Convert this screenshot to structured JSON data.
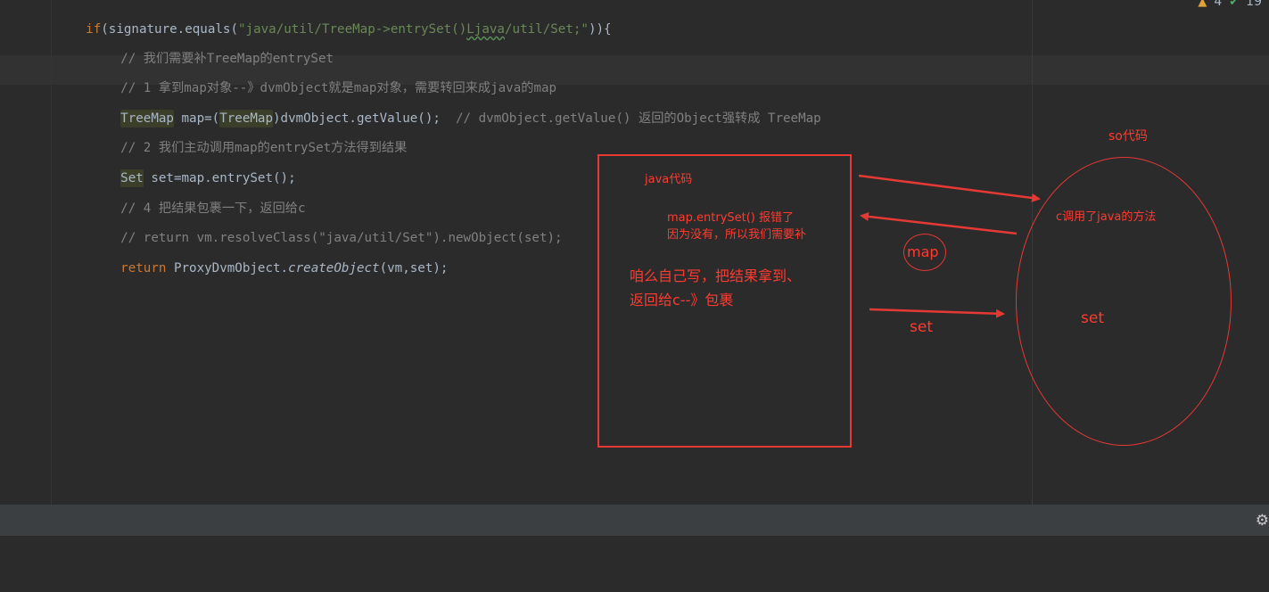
{
  "editor": {
    "lines": [
      {
        "if_kw": "if",
        "pre": "(signature.equals(",
        "str_a": "\"java/util/TreeMap->entrySet()",
        "str_b": "Ljava",
        "str_c": "/util/Set;\"",
        "post": ")){"
      },
      {
        "comment": "// 我们需要补TreeMap的entrySet"
      },
      {
        "comment": "// 1 拿到map对象--》dvmObject就是map对象，需要转回来成java的map"
      },
      {
        "type1": "TreeMap",
        "mid1": " map=(",
        "type2": "TreeMap",
        "mid2": ")dvmObject.getValue();",
        "semi": "",
        "comment": "  // dvmObject.getValue() 返回的Object强转成 TreeMap"
      },
      {
        "comment": "// 2 我们主动调用map的entrySet方法得到结果"
      },
      {
        "type1": "Set",
        "rest": " set=map.entrySet();"
      },
      {
        "comment": "// 4 把结果包裹一下，返回给c"
      },
      {
        "comment": "// return vm.resolveClass(\"java/util/Set\").newObject(set);"
      },
      {
        "ret_kw": "return",
        "pre": " ProxyDvmObject.",
        "method": "createObject",
        "post": "(vm,set);"
      }
    ],
    "inspection": {
      "warnings": "4",
      "ok": "19"
    }
  },
  "annotations": {
    "so_label": "so代码",
    "java_label": "java代码",
    "error_line1": "map.entrySet() 报错了",
    "error_line2": "因为没有，所以我们需要补",
    "self_write_line1": "咱么自己写，把结果拿到、",
    "self_write_line2": "返回给c--》包裹",
    "c_calls_java": "c调用了java的方法",
    "map_label": "map",
    "set_label_left": "set",
    "set_label_right": "set"
  },
  "colors": {
    "annotation": "#e53935",
    "keyword": "#cc7832",
    "string": "#6a8759",
    "comment": "#808080"
  }
}
